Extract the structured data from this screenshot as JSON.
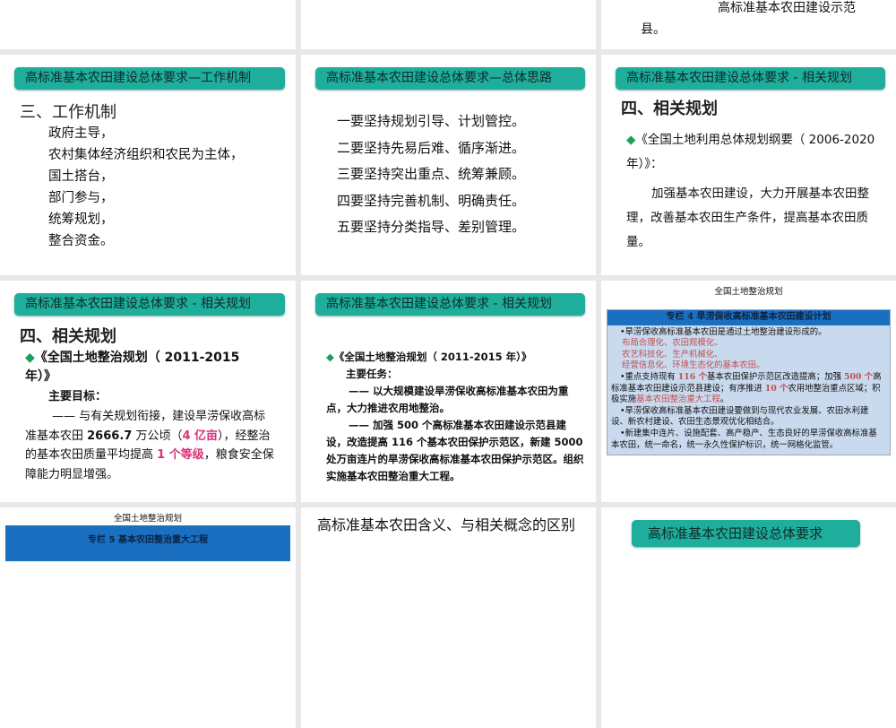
{
  "slides": {
    "s3_top": {
      "line1": "高标准基本农田建设示范",
      "line2": "县。"
    },
    "s4": {
      "header": "高标准基本农田建设总体要求—工作机制",
      "heading": "三、工作机制",
      "lines": [
        "政府主导，",
        "农村集体经济组织和农民为主体，",
        "国土搭台，",
        "部门参与，",
        "统筹规划，",
        "整合资金。"
      ]
    },
    "s5": {
      "header": "高标准基本农田建设总体要求—总体思路",
      "lines": [
        "一要坚持规划引导、计划管控。",
        "二要坚持先易后难、循序渐进。",
        "三要坚持突出重点、统筹兼顾。",
        "四要坚持完善机制、明确责任。",
        "五要坚持分类指导、差别管理。"
      ]
    },
    "s6": {
      "header": "高标准基本农田建设总体要求 - 相关规划",
      "heading": "四、相关规划",
      "bullet": "◆",
      "title": "《全国土地利用总体规划纲要（ 2006-2020 年）》：",
      "body": "加强基本农田建设，大力开展基本农田整理，改善基本农田生产条件，提高基本农田质量。"
    },
    "s7": {
      "header": "高标准基本农田建设总体要求 - 相关规划",
      "heading": "四、相关规划",
      "bullet": "◆",
      "title": "《全国土地整治规划（ 2011-2015 年）》",
      "sub": "主要目标：",
      "p1": "—— 与有关规划衔接，建设旱涝保收高标准基本农田 ",
      "n1": "2666.7",
      "p2": " 万公顷（",
      "n2": "4 亿亩",
      "p3": "），经整治的基本农田质量平均提高 ",
      "n3": "1 个等级",
      "p4": "，粮食安全保障能力明显增强。"
    },
    "s8": {
      "header": "高标准基本农田建设总体要求 - 相关规划",
      "bullet": "◆",
      "title": "《全国土地整治规划（ 2011-2015 年）》",
      "sub": "主要任务：",
      "p1": "—— 以大规模建设旱涝保收高标准基本农田为重点，大力推进农用地整治。",
      "p2": "—— 加强 500 个高标准基本农田建设示范县建设，改造提高 116 个基本农田保护示范区，新建 5000 处万亩连片的旱涝保收高标准基本农田保护示范区。组织实施基本农田整治重大工程。"
    },
    "s9": {
      "title": "全国土地整治规划",
      "box_title": "专栏 4  旱涝保收高标准基本农田建设计划",
      "b1": "•旱涝保收高标准基本农田是通过土地整治建设形成的。",
      "red1": "布局合理化、农田规模化、",
      "red2": "农艺科技化、生产机械化、",
      "red3": "经营信息化、环境生态化的基本农田。",
      "b2a": "•重点支持现有 ",
      "n116": "116 个",
      "b2b": "基本农田保护示范区改造提高；加强 ",
      "n500": "500 个",
      "b2c": "高标准基本农田建设示范县建设；有序推进 ",
      "n10": "10 个",
      "b2d": "农用地整治重点区域；积极实施",
      "red4": "基本农田整治重大工程",
      "b2e": "。",
      "b3": "•旱涝保收高标准基本农田建设要做到与现代农业发展、农田水利建设、新农村建设、农田生态景观优化相结合。",
      "b4": "•新建集中连片、设施配套、高产稳产、生态良好的旱涝保收高标准基本农田，统一命名，统一永久性保护标识，统一网格化监管。"
    },
    "s10": {
      "title": "全国土地整治规划",
      "box_title": "专栏 5  基本农田整治重大工程"
    },
    "s11": {
      "title": "高标准基本农田含义、与相关概念的区别"
    },
    "s12": {
      "header": "高标准基本农田建设总体要求"
    }
  }
}
